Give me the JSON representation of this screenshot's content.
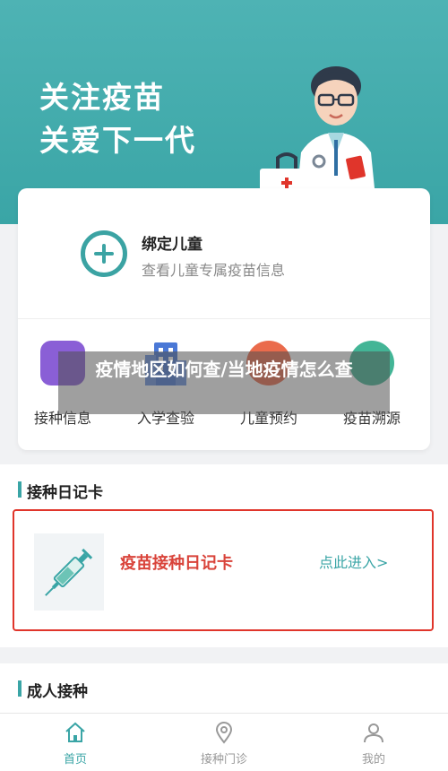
{
  "hero": {
    "line1": "关注疫苗",
    "line2": "关爱下一代"
  },
  "bind_child": {
    "title": "绑定儿童",
    "subtitle": "查看儿童专属疫苗信息"
  },
  "quick_actions": [
    {
      "label": "接种信息",
      "icon": "vaccination-info-icon",
      "color": "#8a5fd6"
    },
    {
      "label": "入学查验",
      "icon": "school-building-icon",
      "color": "#4a78d6"
    },
    {
      "label": "儿童预约",
      "icon": "child-appointment-icon",
      "color": "#ea6b4c"
    },
    {
      "label": "疫苗溯源",
      "icon": "vaccine-trace-icon",
      "color": "#43b596"
    }
  ],
  "overlay": {
    "title": "疫情地区如何查/当地疫情怎么查"
  },
  "diary_section": {
    "title": "接种日记卡",
    "card_label": "疫苗接种日记卡",
    "enter_label": "点此进入>"
  },
  "adult_section": {
    "title": "成人接种"
  },
  "tabbar": [
    {
      "label": "首页",
      "icon": "home-icon",
      "active": true
    },
    {
      "label": "接种门诊",
      "icon": "location-pin-icon",
      "active": false
    },
    {
      "label": "我的",
      "icon": "user-icon",
      "active": false
    }
  ],
  "colors": {
    "accent": "#3aa5a6",
    "highlight_red": "#e0352b",
    "inactive": "#999999"
  }
}
